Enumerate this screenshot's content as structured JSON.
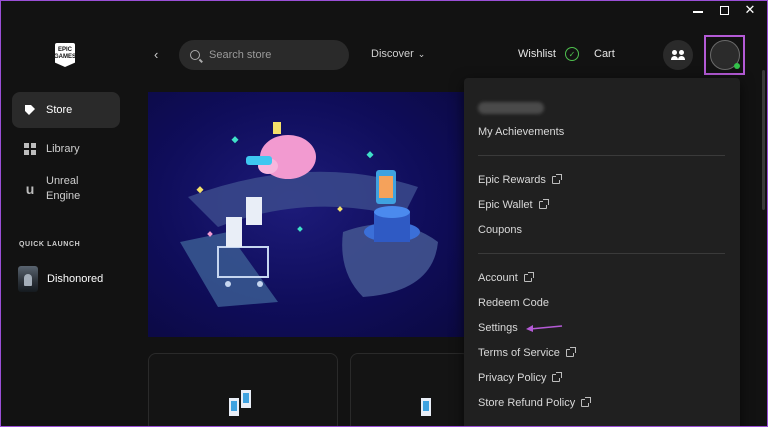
{
  "window": {
    "controls": {
      "minimize": "minimize",
      "maximize": "maximize",
      "close": "✕"
    }
  },
  "sidebar": {
    "logo_text": "EPIC\nGAMES",
    "items": [
      {
        "label": "Store",
        "icon": "tag-icon",
        "active": true
      },
      {
        "label": "Library",
        "icon": "grid-icon",
        "active": false
      },
      {
        "label": "Unreal\nEngine",
        "icon": "unreal-icon",
        "active": false
      }
    ],
    "quick_launch_title": "QUICK LAUNCH",
    "quick_launch_items": [
      {
        "label": "Dishonored"
      }
    ]
  },
  "topbar": {
    "search_placeholder": "Search store",
    "discover_label": "Discover",
    "wishlist_label": "Wishlist",
    "cart_label": "Cart"
  },
  "account_menu": {
    "items": [
      {
        "label": "My Achievements",
        "external": false
      },
      {
        "label": "Epic Rewards",
        "external": true
      },
      {
        "label": "Epic Wallet",
        "external": true
      },
      {
        "label": "Coupons",
        "external": false
      },
      {
        "label": "Account",
        "external": true
      },
      {
        "label": "Redeem Code",
        "external": false
      },
      {
        "label": "Settings",
        "external": false
      },
      {
        "label": "Terms of Service",
        "external": true
      },
      {
        "label": "Privacy Policy",
        "external": true
      },
      {
        "label": "Store Refund Policy",
        "external": true
      }
    ]
  },
  "colors": {
    "accent_purple": "#b45ad6",
    "online_green": "#33c24a",
    "background": "#121212",
    "menu_background": "#202020",
    "hero_background": "#1d1b7a"
  }
}
